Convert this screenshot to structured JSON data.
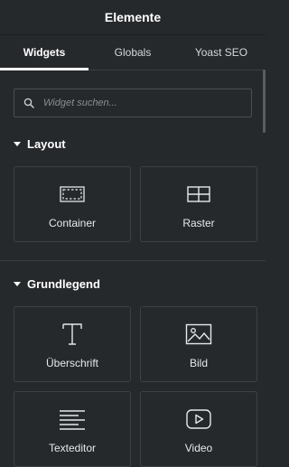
{
  "panel": {
    "title": "Elemente"
  },
  "tabs": [
    {
      "label": "Widgets",
      "active": true
    },
    {
      "label": "Globals",
      "active": false
    },
    {
      "label": "Yoast SEO",
      "active": false
    }
  ],
  "search": {
    "placeholder": "Widget suchen...",
    "icon": "search-icon"
  },
  "sections": [
    {
      "title": "Layout",
      "widgets": [
        {
          "label": "Container",
          "icon": "container-icon"
        },
        {
          "label": "Raster",
          "icon": "grid-icon"
        }
      ]
    },
    {
      "title": "Grundlegend",
      "widgets": [
        {
          "label": "Überschrift",
          "icon": "heading-icon"
        },
        {
          "label": "Bild",
          "icon": "image-icon"
        },
        {
          "label": "Texteditor",
          "icon": "text-editor-icon"
        },
        {
          "label": "Video",
          "icon": "video-icon"
        }
      ]
    }
  ],
  "colors": {
    "background": "#26292c",
    "border": "#3d4044",
    "text": "#e6e8ea"
  }
}
